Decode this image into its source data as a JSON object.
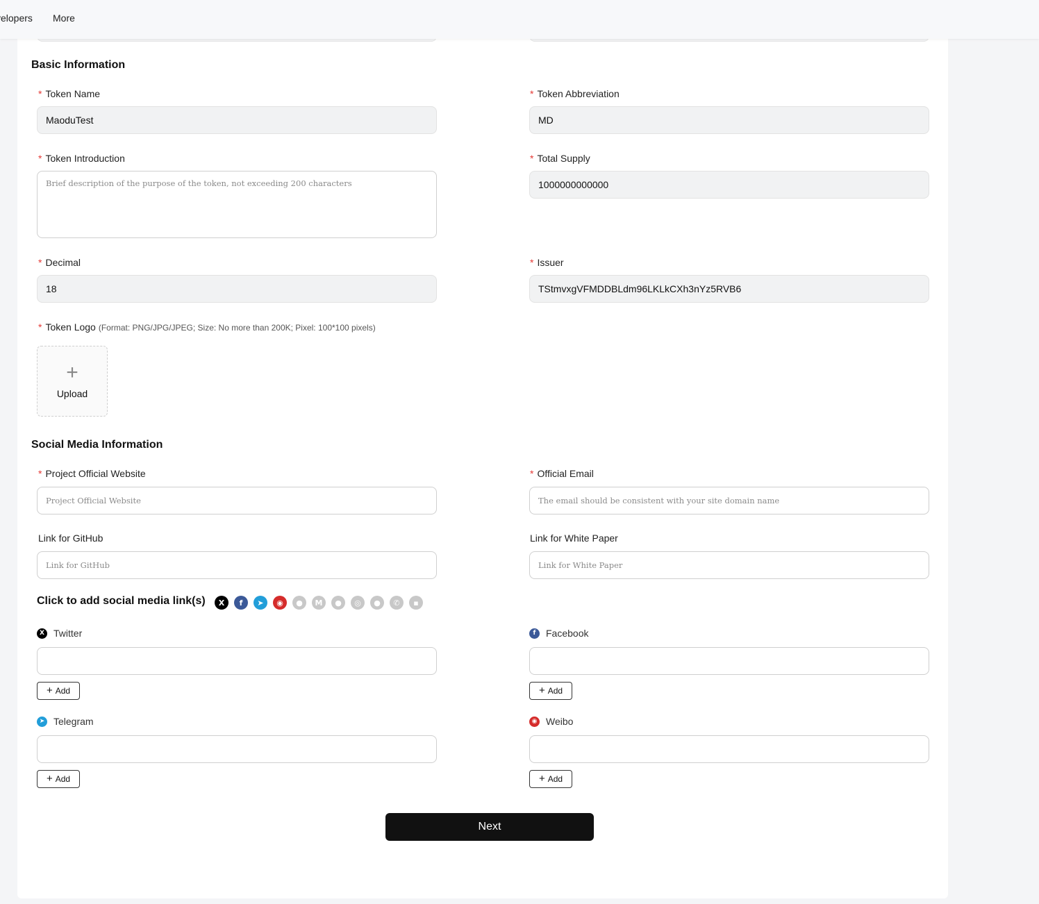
{
  "nav": {
    "items": [
      "velopers",
      "More"
    ]
  },
  "basic": {
    "title": "Basic Information",
    "token_name": {
      "label": "Token Name",
      "value": "MaoduTest"
    },
    "token_abbr": {
      "label": "Token Abbreviation",
      "value": "MD"
    },
    "token_intro": {
      "label": "Token Introduction",
      "placeholder": "Brief description of the purpose of the token, not exceeding 200 characters"
    },
    "total_supply": {
      "label": "Total Supply",
      "value": "1000000000000"
    },
    "decimal": {
      "label": "Decimal",
      "value": "18"
    },
    "issuer": {
      "label": "Issuer",
      "value": "TStmvxgVFMDDBLdm96LKLkCXh3nYz5RVB6"
    },
    "logo": {
      "label": "Token Logo",
      "hint": "(Format: PNG/JPG/JPEG; Size: No more than 200K; Pixel: 100*100 pixels)",
      "upload_label": "Upload"
    }
  },
  "social": {
    "title": "Social Media Information",
    "website": {
      "label": "Project Official Website",
      "placeholder": "Project Official Website"
    },
    "email": {
      "label": "Official Email",
      "placeholder": "The email should be consistent with your site domain name"
    },
    "github": {
      "label": "Link for GitHub",
      "placeholder": "Link for GitHub"
    },
    "whitepaper": {
      "label": "Link for White Paper",
      "placeholder": "Link for White Paper"
    },
    "add_title": "Click to add social media link(s)",
    "icons": [
      {
        "name": "x-icon",
        "glyph": "X",
        "color": "#000000"
      },
      {
        "name": "facebook-icon",
        "glyph": "f",
        "color": "#3b5998"
      },
      {
        "name": "telegram-icon",
        "glyph": "➤",
        "color": "#229ed9"
      },
      {
        "name": "weibo-icon",
        "glyph": "◉",
        "color": "#d52c2b"
      },
      {
        "name": "reddit-icon",
        "glyph": "●",
        "color": "#c8c8c8"
      },
      {
        "name": "medium-icon",
        "glyph": "M",
        "color": "#c8c8c8"
      },
      {
        "name": "github-icon",
        "glyph": "●",
        "color": "#c8c8c8"
      },
      {
        "name": "instagram-icon",
        "glyph": "◎",
        "color": "#c8c8c8"
      },
      {
        "name": "wechat-icon",
        "glyph": "●",
        "color": "#c8c8c8"
      },
      {
        "name": "whatsapp-icon",
        "glyph": "✆",
        "color": "#c8c8c8"
      },
      {
        "name": "discord-icon",
        "glyph": "▪",
        "color": "#c8c8c8"
      }
    ],
    "platforms": {
      "twitter": "Twitter",
      "facebook": "Facebook",
      "telegram": "Telegram",
      "weibo": "Weibo"
    },
    "add_label": "Add"
  },
  "next_label": "Next",
  "colors": {
    "required": "#e53935",
    "primary_button": "#111111"
  }
}
